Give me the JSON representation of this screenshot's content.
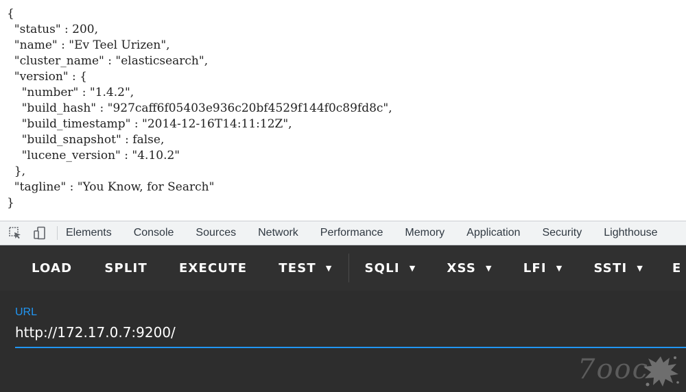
{
  "response": {
    "json_text": "{\n  \"status\" : 200,\n  \"name\" : \"Ev Teel Urizen\",\n  \"cluster_name\" : \"elasticsearch\",\n  \"version\" : {\n    \"number\" : \"1.4.2\",\n    \"build_hash\" : \"927caff6f05403e936c20bf4529f144f0c89fd8c\",\n    \"build_timestamp\" : \"2014-12-16T14:11:12Z\",\n    \"build_snapshot\" : false,\n    \"lucene_version\" : \"4.10.2\"\n  },\n  \"tagline\" : \"You Know, for Search\"\n}"
  },
  "devtools": {
    "icons": [
      "inspect-element-icon",
      "device-toolbar-icon"
    ],
    "tabs": [
      "Elements",
      "Console",
      "Sources",
      "Network",
      "Performance",
      "Memory",
      "Application",
      "Security",
      "Lighthouse"
    ]
  },
  "hackbar": {
    "buttons": {
      "load": "LOAD",
      "split": "SPLIT",
      "execute": "EXECUTE",
      "test": "TEST",
      "sqli": "SQLI",
      "xss": "XSS",
      "lfi": "LFI",
      "ssti": "SSTI",
      "partial": "E"
    },
    "dropdown_icon": "caret-down-icon",
    "url_label": "URL",
    "url_value": "http://172.17.0.7:9200/"
  },
  "watermark": {
    "text": "7ooc"
  },
  "colors": {
    "accent": "#2196f3",
    "toolbar_bg": "#303030",
    "panel_bg": "#2d2d2d",
    "devtools_bg": "#f1f3f4"
  }
}
